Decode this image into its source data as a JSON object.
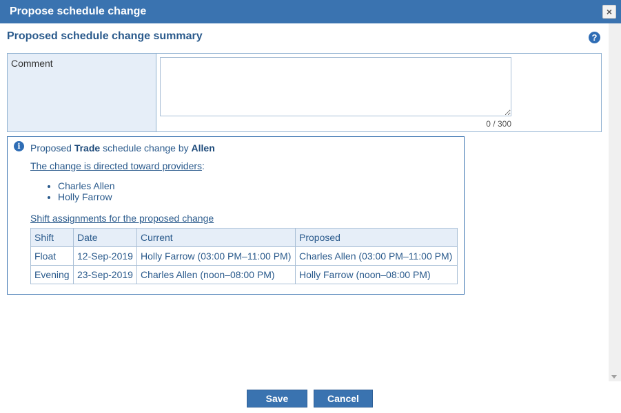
{
  "dialog": {
    "title": "Propose schedule change",
    "close_icon": "×",
    "heading": "Proposed schedule change summary",
    "help_icon": "?"
  },
  "comment": {
    "label": "Comment",
    "value": "",
    "char_count": "0 / 300"
  },
  "info": {
    "prefix": "Proposed ",
    "type": "Trade",
    "middle": " schedule change by ",
    "by": "Allen",
    "directed_link": "The change is directed toward providers",
    "directed_suffix": ":",
    "providers": [
      "Charles Allen",
      "Holly Farrow"
    ],
    "shift_link": "Shift assignments for the proposed change"
  },
  "table": {
    "headers": [
      "Shift",
      "Date",
      "Current",
      "Proposed"
    ],
    "rows": [
      [
        "Float",
        "12-Sep-2019",
        "Holly Farrow (03:00 PM–11:00 PM)",
        "Charles Allen (03:00 PM–11:00 PM)"
      ],
      [
        "Evening",
        "23-Sep-2019",
        "Charles Allen (noon–08:00 PM)",
        "Holly Farrow (noon–08:00 PM)"
      ]
    ]
  },
  "buttons": {
    "save": "Save",
    "cancel": "Cancel"
  },
  "colors": {
    "titlebar": "#3a73b0",
    "accent": "#2f6db5",
    "label_bg": "#e6eef8"
  }
}
